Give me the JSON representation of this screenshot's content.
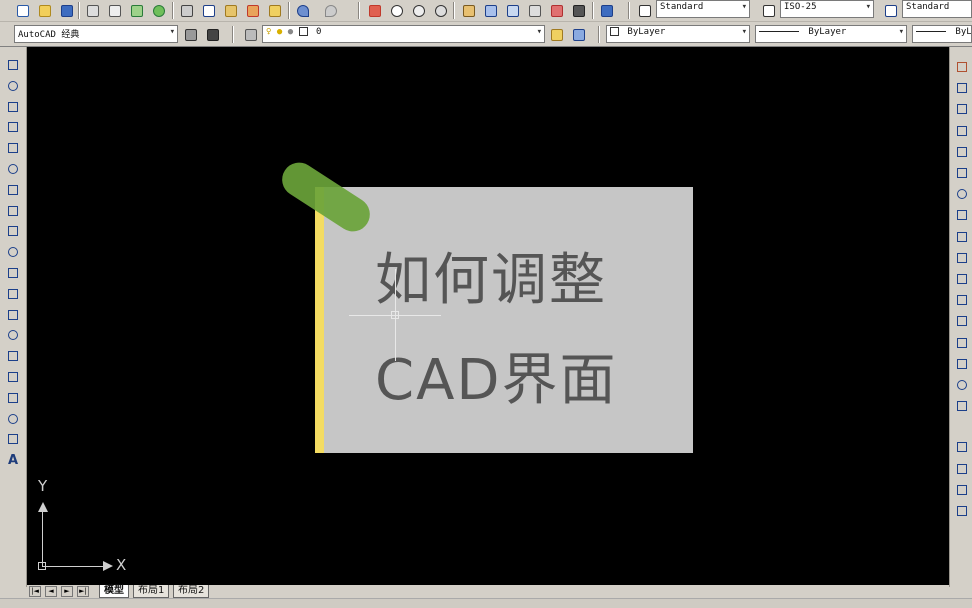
{
  "toolbar_top": {
    "text_style": "Standard",
    "dim_style": "ISO-25",
    "table_style": "Standard"
  },
  "toolbar_second": {
    "workspace": "AutoCAD 经典",
    "layer": "0",
    "color": "ByLayer",
    "linetype": "ByLayer",
    "lineweight": "ByL"
  },
  "colors": {
    "canvas_bg": "#000000",
    "card_bg": "#c6c6c6",
    "card_edge": "#f4dc62",
    "pin": "#6aa33a"
  },
  "left_toolbar": {
    "icons": [
      "line-icon",
      "construction-line-icon",
      "polyline-icon",
      "polygon-icon",
      "rectangle-icon",
      "arc-icon",
      "circle-icon",
      "revision-cloud-icon",
      "spline-icon",
      "ellipse-icon",
      "ellipse-arc-icon",
      "insert-block-icon",
      "make-block-icon",
      "point-icon",
      "hatch-icon",
      "gradient-icon",
      "region-icon",
      "table-icon",
      "multiline-text-icon"
    ],
    "text_button": "A"
  },
  "right_toolbar": {
    "icons": [
      "erase-icon",
      "copy-icon",
      "mirror-icon",
      "offset-icon",
      "array-icon",
      "move-icon",
      "rotate-icon",
      "scale-icon",
      "stretch-icon",
      "trim-icon",
      "extend-icon",
      "break-at-point-icon",
      "break-icon",
      "join-icon",
      "chamfer-icon",
      "fillet-icon",
      "explode-icon",
      "draworder-front-icon",
      "draworder-back-icon",
      "draworder-above-icon",
      "draworder-under-icon"
    ]
  },
  "overlay": {
    "line1": "如何调整",
    "line2": "CAD界面"
  },
  "ucs": {
    "x_label": "X",
    "y_label": "Y"
  },
  "tabs": {
    "nav": [
      "|◄",
      "◄",
      "►",
      "►|"
    ],
    "items": [
      "模型",
      "布局1",
      "布局2"
    ]
  }
}
